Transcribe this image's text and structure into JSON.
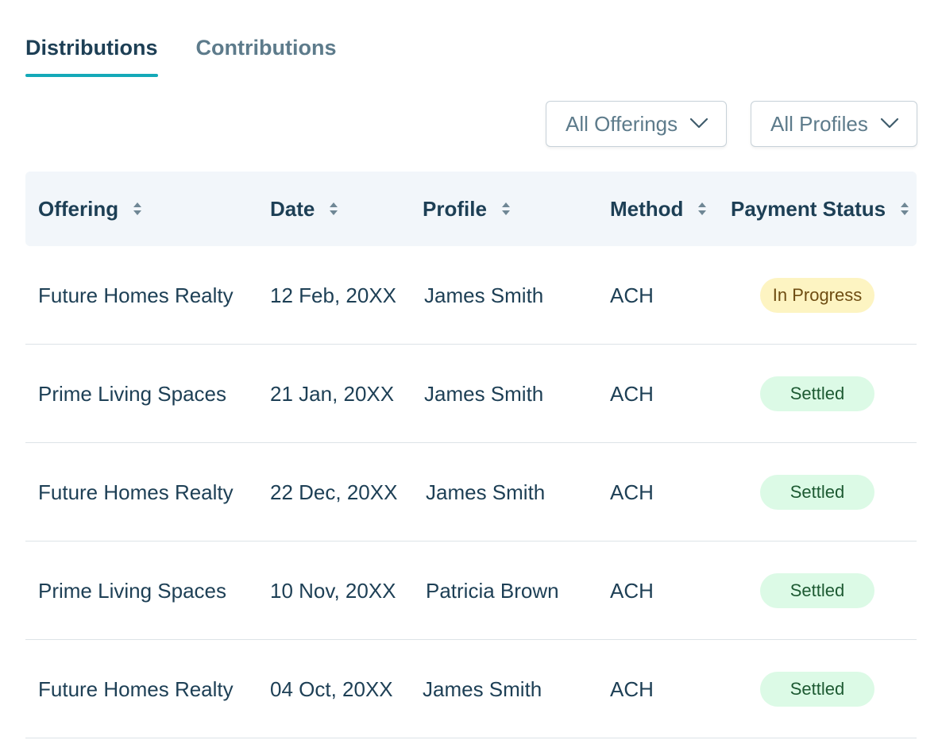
{
  "tabs": [
    {
      "label": "Distributions",
      "active": true
    },
    {
      "label": "Contributions",
      "active": false
    }
  ],
  "filters": {
    "offerings": {
      "label": "All Offerings",
      "icon": "chevron-down-icon"
    },
    "profiles": {
      "label": "All Profiles",
      "icon": "chevron-down-icon"
    }
  },
  "table": {
    "columns": [
      "Offering",
      "Date",
      "Profile",
      "Method",
      "Payment Status"
    ],
    "sort_icon": "sort-icon",
    "rows": [
      {
        "offering": "Future Homes Realty",
        "date": "12 Feb, 20XX",
        "profile": "James Smith",
        "method": "ACH",
        "status": "In Progress"
      },
      {
        "offering": "Prime Living Spaces",
        "date": "21 Jan, 20XX",
        "profile": "James Smith",
        "method": "ACH",
        "status": "Settled"
      },
      {
        "offering": "Future Homes Realty",
        "date": "22 Dec, 20XX",
        "profile": "James Smith",
        "method": "ACH",
        "status": "Settled"
      },
      {
        "offering": "Prime Living Spaces",
        "date": "10 Nov, 20XX",
        "profile": "Patricia Brown",
        "method": "ACH",
        "status": "Settled"
      },
      {
        "offering": "Future Homes Realty",
        "date": "04 Oct, 20XX",
        "profile": "James Smith",
        "method": "ACH",
        "status": "Settled"
      }
    ]
  },
  "colors": {
    "accent": "#14a9b8",
    "text_primary": "#1d3f55",
    "text_muted": "#5d7b8b",
    "header_bg": "#f2f6fa",
    "status_in_progress_bg": "#fdf4c2",
    "status_settled_bg": "#dcfae6"
  }
}
